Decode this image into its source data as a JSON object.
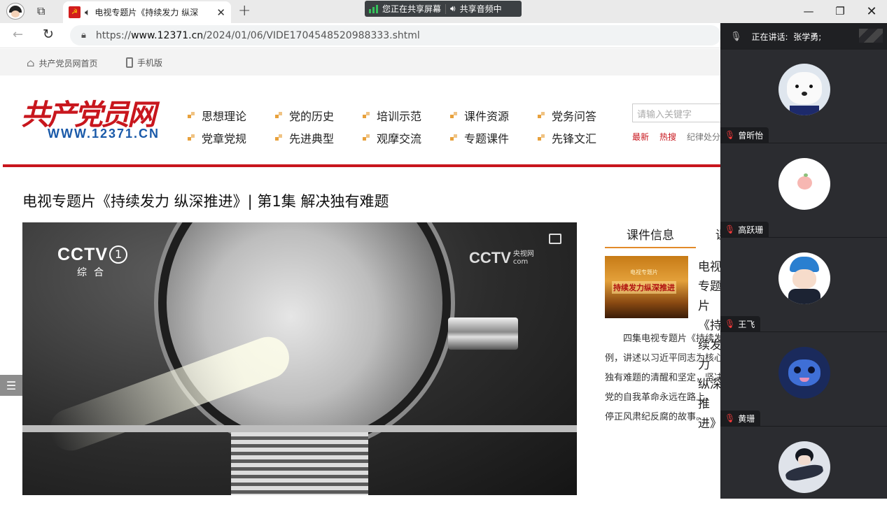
{
  "browser": {
    "tab_title": "电视专题片《持续发力 纵深",
    "new_tab": "+",
    "share_status": "您正在共享屏幕",
    "share_audio": "共享音频中",
    "url_host": "www.12371.cn",
    "url_scheme": "https://",
    "url_path": "/2024/01/06/VIDE1704548520988333.shtml"
  },
  "site": {
    "home_link": "共产党员网首页",
    "mobile_link": "手机版",
    "logo_cn": "共产党员网",
    "logo_url": "WWW.12371.CN",
    "nav_row1": [
      "思想理论",
      "党的历史",
      "培训示范",
      "课件资源",
      "党务问答"
    ],
    "nav_row2": [
      "党章党规",
      "先进典型",
      "观摩交流",
      "专题课件",
      "先锋文汇"
    ],
    "search_placeholder": "请输入关键字",
    "hot_links": [
      "最新",
      "热搜",
      "纪律处分"
    ],
    "page_title": "电视专题片《持续发力 纵深推进》| 第1集 解决独有难题"
  },
  "video": {
    "channel_brand": "CCTV",
    "channel_number": "1",
    "channel_sub": "综合",
    "cctvcom_brand": "CCTV",
    "cctvcom_side": [
      "央视网",
      "com"
    ]
  },
  "course": {
    "tab_info": "课件信息",
    "tab_second": "课",
    "thumb_line1": "电视专题片",
    "thumb_line2": "持续发力纵深推进",
    "name": "电视专题片《持续发力 纵深推进》",
    "desc_lines": [
      "　　四集电视专题片《持续发力 纵深推进》以案说纪、以案明",
      "例，讲述以习近平同志为核心的党中央以伟大自我革命引领伟大社会革命，",
      "独有难题的清醒和坚定，坚决打赢反腐败斗争攻坚战持久战，",
      "党的自我革命永远在路上，",
      "停正风肃纪反腐的故事。"
    ]
  },
  "meeting": {
    "speaking_label": "正在讲话:",
    "speaking_name": "张学勇;",
    "participants": [
      {
        "name": "曾昕怡",
        "avatar": "white-dog-avatar"
      },
      {
        "name": "高跃珊",
        "avatar": "peach-avatar"
      },
      {
        "name": "王飞",
        "avatar": "boy-cap-avatar"
      },
      {
        "name": "黄珊",
        "avatar": "stitch-avatar"
      },
      {
        "name": "",
        "avatar": "anime-avatar"
      }
    ]
  },
  "colors": {
    "brand_red": "#c8161d",
    "brand_blue": "#1a5aa9",
    "accent_orange": "#e28a2a"
  }
}
